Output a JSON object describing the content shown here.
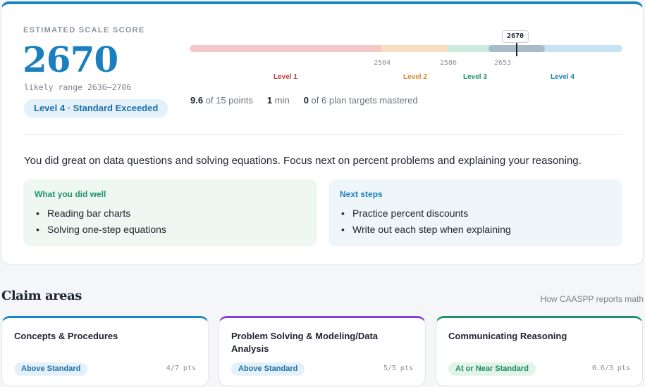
{
  "score_card": {
    "eyebrow": "ESTIMATED SCALE SCORE",
    "score": "2670",
    "likely_range": "likely range 2636–2706",
    "level_badge": "Level 4 · Standard Exceeded",
    "bar": {
      "marker_label": "2670",
      "cut_scores": [
        "2504",
        "2586",
        "2653"
      ],
      "levels": [
        "Level 1",
        "Level 2",
        "Level 3",
        "Level 4"
      ]
    },
    "stats": {
      "points_value": "9.6",
      "points_suffix": " of 15 points",
      "time_value": "1",
      "time_suffix": " min",
      "targets_value": "0",
      "targets_suffix": " of 6 plan targets mastered"
    },
    "summary": "You did great on data questions and solving equations. Focus next on percent problems and explaining your reasoning.",
    "did_well": {
      "title": "What you did well",
      "items": [
        "Reading bar charts",
        "Solving one-step equations"
      ]
    },
    "next_steps": {
      "title": "Next steps",
      "items": [
        "Practice percent discounts",
        "Write out each step when explaining"
      ]
    }
  },
  "claims": {
    "title": "Claim areas",
    "link": "How CAASPP reports math",
    "cards": [
      {
        "name": "Concepts & Procedures",
        "badge": "Above Standard",
        "points": "4/7 pts"
      },
      {
        "name": "Problem Solving & Modeling/Data Analysis",
        "badge": "Above Standard",
        "points": "5/5 pts"
      },
      {
        "name": "Communicating Reasoning",
        "badge": "At or Near Standard",
        "points": "0.6/3 pts"
      }
    ]
  },
  "colors": {
    "accent": "#1a87c3",
    "level1": "#c43838",
    "level2": "#d5862b",
    "level3": "#1c9467",
    "level4": "#1a7fbd",
    "claim_problem_solving": "#8a3fcf"
  }
}
